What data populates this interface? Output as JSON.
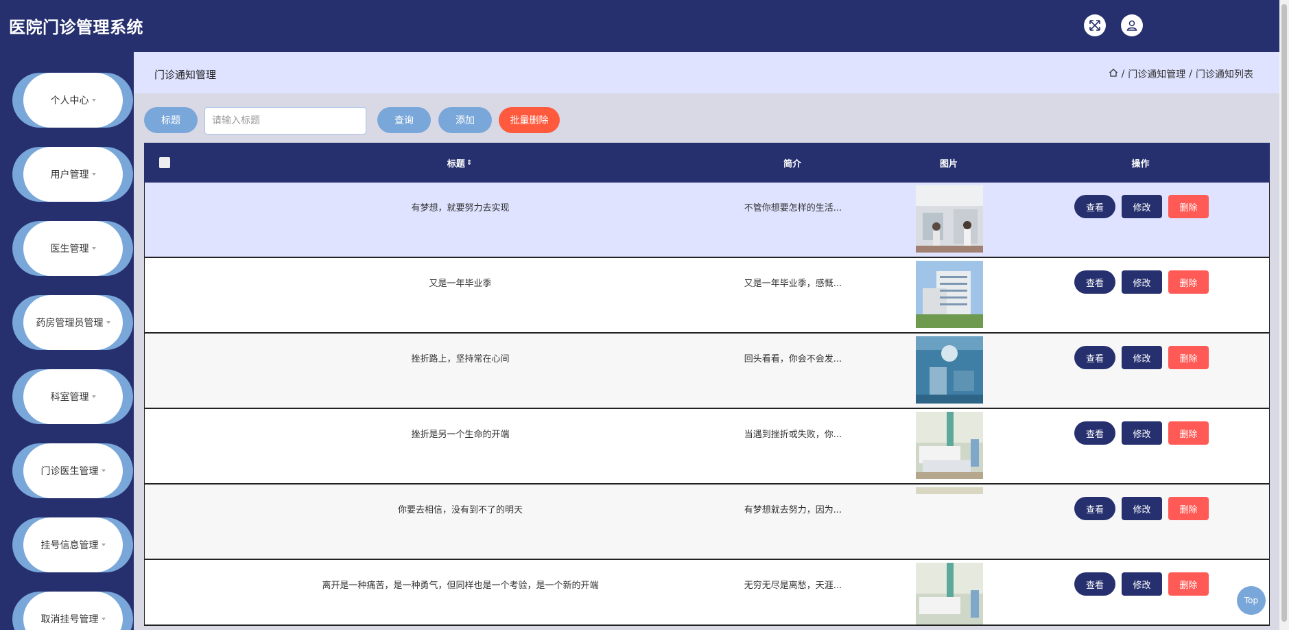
{
  "app": {
    "title": "医院门诊管理系统"
  },
  "header": {
    "fullscreen_icon": "expand-icon",
    "user_icon": "user-icon"
  },
  "sidebar": {
    "items": [
      {
        "label": "个人中心"
      },
      {
        "label": "用户管理"
      },
      {
        "label": "医生管理"
      },
      {
        "label": "药房管理员管理"
      },
      {
        "label": "科室管理"
      },
      {
        "label": "门诊医生管理"
      },
      {
        "label": "挂号信息管理"
      },
      {
        "label": "取消挂号管理"
      }
    ]
  },
  "page": {
    "title": "门诊通知管理",
    "breadcrumb": [
      "门诊通知管理",
      "门诊通知列表"
    ]
  },
  "toolbar": {
    "field_label": "标题",
    "search_placeholder": "请输入标题",
    "search_value": "",
    "query_label": "查询",
    "add_label": "添加",
    "batch_delete_label": "批量删除"
  },
  "table": {
    "columns": {
      "title": "标题",
      "intro": "简介",
      "image": "图片",
      "actions": "操作"
    },
    "rows": [
      {
        "title": "有梦想，就要努力去实现",
        "intro": "不管你想要怎样的生活...",
        "image": "clinic-lobby"
      },
      {
        "title": "又是一年毕业季",
        "intro": "又是一年毕业季，感慨...",
        "image": "hospital-building"
      },
      {
        "title": "挫折路上，坚持常在心间",
        "intro": "回头看看，你会不会发...",
        "image": "operating-room"
      },
      {
        "title": "挫折是另一个生命的开端",
        "intro": "当遇到挫折或失败，你...",
        "image": "ward-beds"
      },
      {
        "title": "你要去相信，没有到不了的明天",
        "intro": "有梦想就去努力，因为...",
        "image": "blank"
      },
      {
        "title": "离开是一种痛苦，是一种勇气，但同样也是一个考验，是一个新的开端",
        "intro": "无穷无尽是离愁，天涯...",
        "image": "ward-beds"
      }
    ],
    "actions": {
      "view": "查看",
      "edit": "修改",
      "delete": "删除"
    }
  },
  "back_to_top": "Top",
  "colors": {
    "primary": "#26306e",
    "accent": "#7aa7d9",
    "danger": "#ff5a55",
    "crumb_bg": "#dfe3ff"
  }
}
